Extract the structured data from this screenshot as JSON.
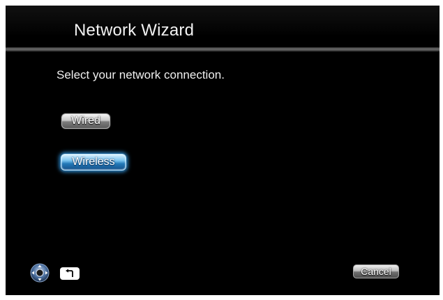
{
  "header": {
    "title": "Network Wizard"
  },
  "main": {
    "prompt": "Select your network connection.",
    "options": [
      {
        "label": "Wired",
        "selected": false
      },
      {
        "label": "Wireless",
        "selected": true
      }
    ]
  },
  "footer": {
    "nav_icon": "remote-dpad-icon",
    "back_icon": "return-arrow-icon",
    "cancel_label": "Cancel"
  },
  "colors": {
    "background": "#000000",
    "selected_accent": "#2f8fd6",
    "text": "#f0f0f0"
  }
}
